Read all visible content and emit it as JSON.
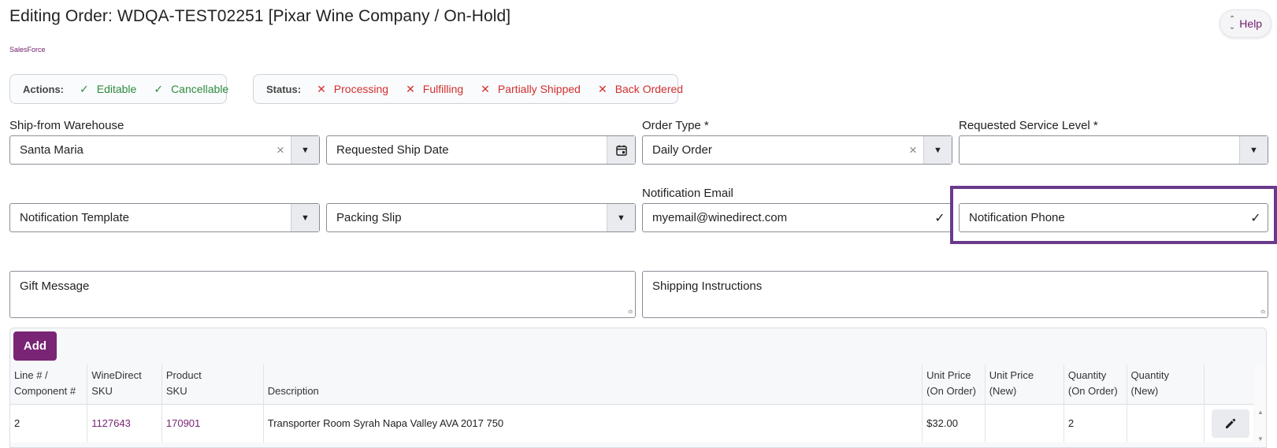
{
  "page": {
    "title": "Editing Order: WDQA-TEST02251 [Pixar Wine Company / On-Hold]",
    "subtitle": "SalesForce",
    "help_label": "Help"
  },
  "actions": {
    "label": "Actions:",
    "items": [
      {
        "label": "Editable",
        "state": "ok"
      },
      {
        "label": "Cancellable",
        "state": "ok"
      }
    ]
  },
  "status": {
    "label": "Status:",
    "items": [
      {
        "label": "Processing",
        "state": "no"
      },
      {
        "label": "Fulfilling",
        "state": "no"
      },
      {
        "label": "Partially Shipped",
        "state": "no"
      },
      {
        "label": "Back Ordered",
        "state": "no"
      }
    ]
  },
  "form": {
    "warehouse": {
      "label": "Ship-from Warehouse",
      "value": "Santa Maria"
    },
    "ship_date": {
      "placeholder": "Requested Ship Date"
    },
    "order_type": {
      "label": "Order Type *",
      "value": "Daily Order"
    },
    "service_level": {
      "label": "Requested Service Level *",
      "value": ""
    },
    "notification_template": {
      "placeholder": "Notification Template"
    },
    "packing_slip": {
      "placeholder": "Packing Slip"
    },
    "notification_email": {
      "label": "Notification Email",
      "value": "myemail@winedirect.com"
    },
    "notification_phone": {
      "placeholder": "Notification Phone"
    },
    "gift_message": {
      "placeholder": "Gift Message"
    },
    "shipping_instructions": {
      "placeholder": "Shipping Instructions"
    }
  },
  "table": {
    "add_label": "Add",
    "headers": [
      [
        "Line # /",
        "Component #"
      ],
      [
        "WineDirect",
        "SKU"
      ],
      [
        "Product",
        "SKU"
      ],
      [
        "",
        "Description"
      ],
      [
        "Unit Price",
        "(On Order)"
      ],
      [
        "Unit Price",
        "(New)"
      ],
      [
        "Quantity",
        "(On Order)"
      ],
      [
        "Quantity",
        "(New)"
      ],
      [
        "",
        ""
      ]
    ],
    "rows": [
      {
        "line": "2",
        "wd_sku": "1127643",
        "product_sku": "170901",
        "description": "Transporter Room Syrah Napa Valley AVA 2017 750",
        "unit_price_on_order": "$32.00",
        "unit_price_new": "",
        "quantity_on_order": "2",
        "quantity_new": ""
      }
    ]
  },
  "icons": {
    "ok": "check-icon",
    "no": "x-icon",
    "clear": "clear-x-icon",
    "dropdown": "caret-down-icon",
    "calendar": "calendar-icon",
    "valid": "checkmark-icon",
    "edit": "pencil-icon"
  },
  "colors": {
    "brand": "#7a2475",
    "ok": "#2e8b3e",
    "error": "#d32f2f",
    "highlight": "#6a3a8c"
  }
}
